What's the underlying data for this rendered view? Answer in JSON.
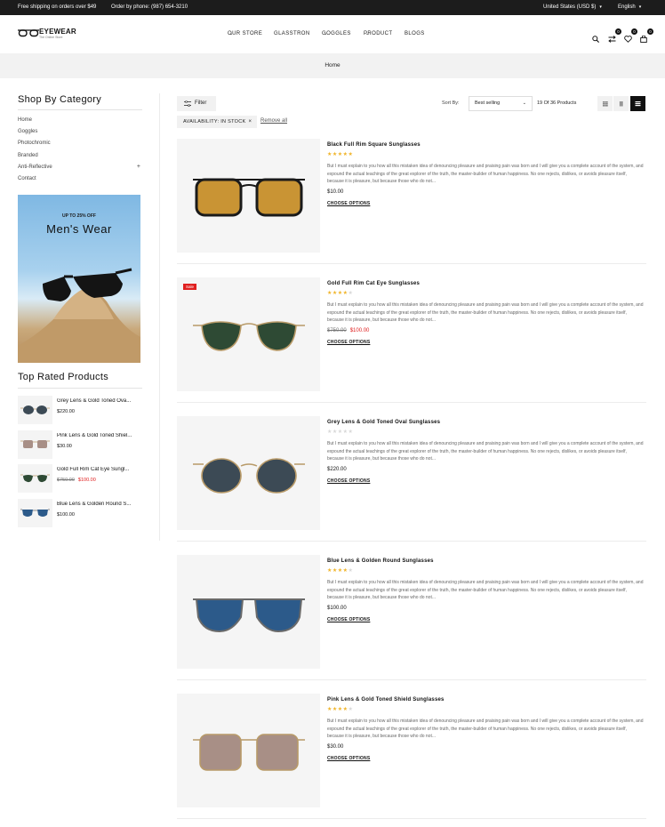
{
  "topbar": {
    "free_shipping": "Free shipping on orders over $49",
    "phone": "Order by phone: (987) 654-3210",
    "currency": "United States (USD $)",
    "language": "English"
  },
  "header": {
    "logo_name": "EYEWEAR",
    "logo_tagline": "The Online Store",
    "nav": [
      {
        "label": "OUR STORE",
        "dropdown": true
      },
      {
        "label": "GLASSTRON",
        "dropdown": false
      },
      {
        "label": "GOGGLES",
        "dropdown": true
      },
      {
        "label": "PRODUCT",
        "dropdown": true
      },
      {
        "label": "BLOGS",
        "dropdown": false
      }
    ],
    "icons": [
      "search-icon",
      "compare-icon",
      "wishlist-icon",
      "cart-icon"
    ],
    "compare_count": "0",
    "wishlist_count": "0",
    "cart_count": "0"
  },
  "breadcrumb": "Home",
  "sidebar": {
    "category_title": "Shop By Category",
    "categories": [
      "Home",
      "Goggles",
      "Photochromic",
      "Branded",
      "Anti-Reflective",
      "Contact"
    ],
    "banner_promo": "UP TO 25% OFF",
    "banner_title": "Men's Wear",
    "top_rated_title": "Top Rated Products",
    "top_rated": [
      {
        "name": "Grey Lens & Gold Toned Ova...",
        "price": "$220.00",
        "old_price": "",
        "lens": "#3c4a55"
      },
      {
        "name": "Pink Lens & Gold Toned Shiel...",
        "price": "$30.00",
        "old_price": "",
        "lens": "#a88f86"
      },
      {
        "name": "Gold Full Rim Cat Eye Sungl...",
        "price": "$100.00",
        "old_price": "$750.00",
        "lens": "#2e4a34"
      },
      {
        "name": "Blue Lens & Golden Round S...",
        "price": "$100.00",
        "old_price": "",
        "lens": "#2c5a8a"
      }
    ]
  },
  "toolbar": {
    "filter_label": "Filter",
    "active_filter": "AVAILABILITY: IN STOCK",
    "remove_all": "Remove all",
    "sort_label": "Sort By:",
    "sort_value": "Best selling",
    "count": "19 Of 36 Products"
  },
  "products": [
    {
      "name": "Black Full Rim Square Sunglasses",
      "rating": 5,
      "price": "$10.00",
      "old_price": "",
      "sale": false,
      "choose": "CHOOSE OPTIONS",
      "lens": "#c99434",
      "frame": "#1a1a1a",
      "desc": "But I must explain to you how all this mistaken idea of denouncing pleasure and praising pain was born and I will give you a complete account of the system, and expound the actual teachings of the great explorer of the truth, the master-builder of human happiness. No one rejects, dislikes, or avoids pleasure itself, because it is pleasure, but because those who do not..."
    },
    {
      "name": "Gold Full Rim Cat Eye Sunglasses",
      "rating": 4,
      "price": "$100.00",
      "old_price": "$750.00",
      "sale": true,
      "sale_label": "Sale",
      "choose": "CHOOSE OPTIONS",
      "lens": "#2e4a34",
      "frame": "#b89a68",
      "desc": "But I must explain to you how all this mistaken idea of denouncing pleasure and praising pain was born and I will give you a complete account of the system, and expound the actual teachings of the great explorer of the truth, the master-builder of human happiness. No one rejects, dislikes, or avoids pleasure itself, because it is pleasure, but because those who do not..."
    },
    {
      "name": "Grey Lens & Gold Toned Oval Sunglasses",
      "rating": 0,
      "price": "$220.00",
      "old_price": "",
      "sale": false,
      "choose": "CHOOSE OPTIONS",
      "lens": "#3c4a55",
      "frame": "#b89a68",
      "desc": "But I must explain to you how all this mistaken idea of denouncing pleasure and praising pain was born and I will give you a complete account of the system, and expound the actual teachings of the great explorer of the truth, the master-builder of human happiness. No one rejects, dislikes, or avoids pleasure itself, because it is pleasure, but because those who do not..."
    },
    {
      "name": "Blue Lens & Golden Round Sunglasses",
      "rating": 4,
      "price": "$100.00",
      "old_price": "",
      "sale": false,
      "choose": "CHOOSE OPTIONS",
      "lens": "#2c5a8a",
      "frame": "#6a6a6a",
      "desc": "But I must explain to you how all this mistaken idea of denouncing pleasure and praising pain was born and I will give you a complete account of the system, and expound the actual teachings of the great explorer of the truth, the master-builder of human happiness. No one rejects, dislikes, or avoids pleasure itself, because it is pleasure, but because those who do not..."
    },
    {
      "name": "Pink Lens & Gold Toned Shield Sunglasses",
      "rating": 4,
      "price": "$30.00",
      "old_price": "",
      "sale": false,
      "choose": "CHOOSE OPTIONS",
      "lens": "#a88f86",
      "frame": "#b89a68",
      "desc": "But I must explain to you how all this mistaken idea of denouncing pleasure and praising pain was born and I will give you a complete account of the system, and expound the actual teachings of the great explorer of the truth, the master-builder of human happiness. No one rejects, dislikes, or avoids pleasure itself, because it is pleasure, but because those who do not..."
    }
  ]
}
